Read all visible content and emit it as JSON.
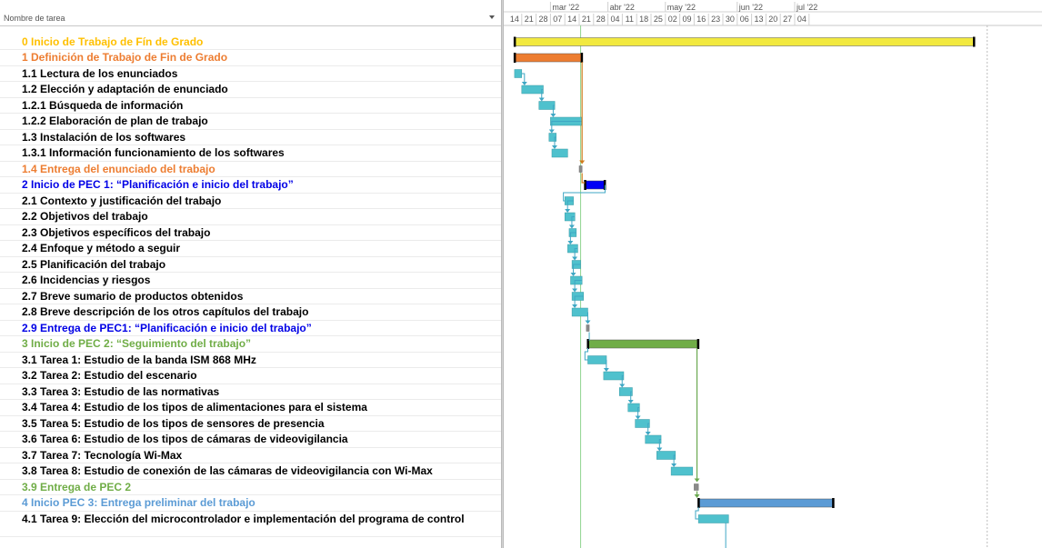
{
  "grid": {
    "column_header": "Nombre de tarea",
    "sort_icon": "dropdown-arrow-icon"
  },
  "colors": {
    "yellow": "#f2e93f",
    "orange": "#ed7d31",
    "teal": "#4fc1cd",
    "blue": "#0000f5",
    "green": "#70ad47",
    "lightblue": "#5b9bd5",
    "black": "#000000",
    "link_orange": "#d07a1a",
    "link_blue": "#3fa7c4",
    "link_green": "#6aa84f",
    "gray": "#a8a8a8"
  },
  "timeline": {
    "months": [
      "mar '22",
      "abr '22",
      "may '22",
      "jun '22",
      "jul '22"
    ],
    "days": [
      "14",
      "21",
      "28",
      "07",
      "14",
      "21",
      "28",
      "04",
      "11",
      "18",
      "25",
      "02",
      "09",
      "16",
      "23",
      "30",
      "06",
      "13",
      "20",
      "27",
      "04"
    ]
  },
  "tasks": [
    {
      "name": "0 Inicio de Trabajo de Fín de Grado",
      "color": "#ffc000",
      "bold": true
    },
    {
      "name": "1 Definición de Trabajo de Fin de Grado",
      "color": "#ed7d31",
      "bold": true
    },
    {
      "name": "1.1 Lectura de los enunciados",
      "color": "#000000",
      "bold": true
    },
    {
      "name": "1.2 Elección y adaptación de enunciado",
      "color": "#000000",
      "bold": true
    },
    {
      "name": "1.2.1 Búsqueda de información",
      "color": "#000000",
      "bold": true
    },
    {
      "name": "1.2.2 Elaboración de plan de trabajo",
      "color": "#000000",
      "bold": true
    },
    {
      "name": "1.3 Instalación de los softwares",
      "color": "#000000",
      "bold": true
    },
    {
      "name": "1.3.1 Información funcionamiento de los softwares",
      "color": "#000000",
      "bold": true
    },
    {
      "name": "1.4 Entrega del enunciado del trabajo",
      "color": "#ed7d31",
      "bold": true
    },
    {
      "name": "2 Inicio de PEC 1: “Planificación e inicio del trabajo”",
      "color": "#0000e6",
      "bold": true
    },
    {
      "name": "2.1 Contexto y justificación del trabajo",
      "color": "#000000",
      "bold": true
    },
    {
      "name": "2.2 Objetivos del trabajo",
      "color": "#000000",
      "bold": true
    },
    {
      "name": "2.3 Objetivos específicos del trabajo",
      "color": "#000000",
      "bold": true
    },
    {
      "name": "2.4 Enfoque y método a seguir",
      "color": "#000000",
      "bold": true
    },
    {
      "name": "2.5 Planificación del trabajo",
      "color": "#000000",
      "bold": true
    },
    {
      "name": "2.6 Incidencias y riesgos",
      "color": "#000000",
      "bold": true
    },
    {
      "name": "2.7 Breve sumario de productos obtenidos",
      "color": "#000000",
      "bold": true
    },
    {
      "name": "2.8 Breve descripción de los otros capítulos del trabajo",
      "color": "#000000",
      "bold": true
    },
    {
      "name": "2.9 Entrega de PEC1: “Planificación e inicio del trabajo”",
      "color": "#0000e6",
      "bold": true
    },
    {
      "name": "3 Inicio de PEC 2: “Seguimiento del trabajo”",
      "color": "#70ad47",
      "bold": true
    },
    {
      "name": "3.1 Tarea 1: Estudio de la banda ISM 868 MHz",
      "color": "#000000",
      "bold": true
    },
    {
      "name": "3.2 Tarea 2: Estudio del escenario",
      "color": "#000000",
      "bold": true
    },
    {
      "name": "3.3 Tarea 3: Estudio de las normativas",
      "color": "#000000",
      "bold": true
    },
    {
      "name": "3.4 Tarea 4: Estudio de los tipos de alimentaciones para el sistema",
      "color": "#000000",
      "bold": true
    },
    {
      "name": "3.5 Tarea 5: Estudio de los tipos de sensores de presencia",
      "color": "#000000",
      "bold": true
    },
    {
      "name": "3.6 Tarea 6: Estudio de los tipos de cámaras de videovigilancia",
      "color": "#000000",
      "bold": true
    },
    {
      "name": "3.7 Tarea 7: Tecnología Wi-Max",
      "color": "#000000",
      "bold": true
    },
    {
      "name": "3.8 Tarea 8: Estudio de conexión de las cámaras de videovigilancia con Wi-Max",
      "color": "#000000",
      "bold": true
    },
    {
      "name": "3.9  Entrega de PEC 2",
      "color": "#70ad47",
      "bold": true
    },
    {
      "name": "4 Inicio PEC 3: Entrega preliminar del trabajo",
      "color": "#5b9bd5",
      "bold": true
    },
    {
      "name": "4.1  Tarea 9: Elección del microcontrolador e implementación del programa de control",
      "color": "#000000",
      "bold": true
    }
  ],
  "bars": [
    {
      "row": 0,
      "start": 0.5,
      "end": 32.5,
      "type": "summary",
      "color": "#f2e93f"
    },
    {
      "row": 1,
      "start": 0.5,
      "end": 5.2,
      "type": "summary",
      "color": "#ed7d31"
    },
    {
      "row": 2,
      "start": 0.5,
      "end": 1.0,
      "type": "task"
    },
    {
      "row": 3,
      "start": 1.0,
      "end": 2.5,
      "type": "task"
    },
    {
      "row": 4,
      "start": 2.2,
      "end": 3.3,
      "type": "task"
    },
    {
      "row": 5,
      "start": 3.0,
      "end": 5.2,
      "type": "task"
    },
    {
      "row": 6,
      "start": 2.9,
      "end": 3.4,
      "type": "task"
    },
    {
      "row": 7,
      "start": 3.1,
      "end": 4.2,
      "type": "task"
    },
    {
      "row": 8,
      "start": 5.0,
      "end": 5.2,
      "type": "milestone"
    },
    {
      "row": 9,
      "start": 5.4,
      "end": 6.8,
      "type": "summary",
      "color": "#0000f5"
    },
    {
      "row": 10,
      "start": 4.0,
      "end": 4.6,
      "type": "task"
    },
    {
      "row": 11,
      "start": 4.0,
      "end": 4.7,
      "type": "task"
    },
    {
      "row": 12,
      "start": 4.3,
      "end": 4.8,
      "type": "task"
    },
    {
      "row": 13,
      "start": 4.2,
      "end": 4.9,
      "type": "task"
    },
    {
      "row": 14,
      "start": 4.5,
      "end": 5.1,
      "type": "task"
    },
    {
      "row": 15,
      "start": 4.4,
      "end": 5.2,
      "type": "task"
    },
    {
      "row": 16,
      "start": 4.5,
      "end": 5.3,
      "type": "task"
    },
    {
      "row": 17,
      "start": 4.5,
      "end": 5.6,
      "type": "task"
    },
    {
      "row": 18,
      "start": 5.5,
      "end": 5.7,
      "type": "milestone"
    },
    {
      "row": 19,
      "start": 5.6,
      "end": 13.3,
      "type": "summary",
      "color": "#70ad47"
    },
    {
      "row": 20,
      "start": 5.6,
      "end": 6.9,
      "type": "task"
    },
    {
      "row": 21,
      "start": 6.7,
      "end": 8.1,
      "type": "task"
    },
    {
      "row": 22,
      "start": 7.8,
      "end": 8.7,
      "type": "task"
    },
    {
      "row": 23,
      "start": 8.4,
      "end": 9.2,
      "type": "task"
    },
    {
      "row": 24,
      "start": 8.9,
      "end": 9.9,
      "type": "task"
    },
    {
      "row": 25,
      "start": 9.6,
      "end": 10.7,
      "type": "task"
    },
    {
      "row": 26,
      "start": 10.4,
      "end": 11.7,
      "type": "task"
    },
    {
      "row": 27,
      "start": 11.4,
      "end": 12.9,
      "type": "task"
    },
    {
      "row": 28,
      "start": 13.0,
      "end": 13.3,
      "type": "milestone"
    },
    {
      "row": 29,
      "start": 13.3,
      "end": 22.7,
      "type": "summary",
      "color": "#5b9bd5"
    },
    {
      "row": 30,
      "start": 13.3,
      "end": 15.4,
      "type": "task"
    }
  ]
}
